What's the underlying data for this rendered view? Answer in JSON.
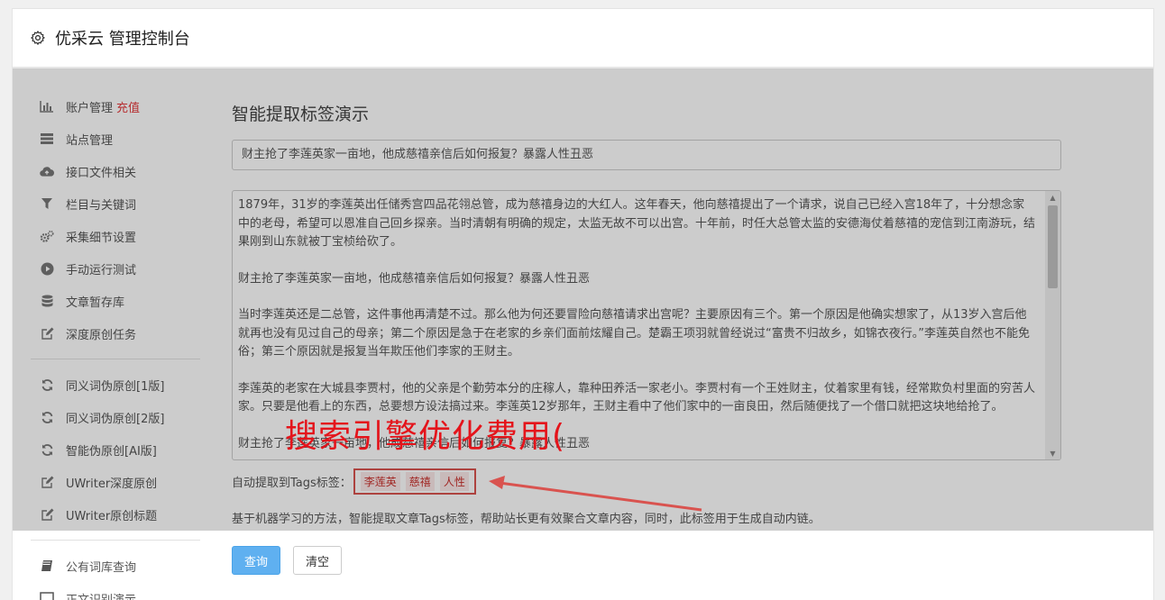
{
  "header": {
    "title": "优采云 管理控制台",
    "icon": "gear-icon"
  },
  "sidebar": {
    "items": [
      {
        "label": "账户管理",
        "badge": "充值",
        "icon": "bar-chart-icon"
      },
      {
        "label": "站点管理",
        "icon": "server-icon"
      },
      {
        "label": "接口文件相关",
        "icon": "cloud-upload-icon"
      },
      {
        "label": "栏目与关键词",
        "icon": "filter-icon"
      },
      {
        "label": "采集细节设置",
        "icon": "cogs-icon"
      },
      {
        "label": "手动运行测试",
        "icon": "play-circle-icon"
      },
      {
        "label": "文章暂存库",
        "icon": "database-icon"
      },
      {
        "label": "深度原创任务",
        "icon": "edit-icon"
      }
    ],
    "items2": [
      {
        "label": "同义词伪原创[1版]",
        "icon": "refresh-icon"
      },
      {
        "label": "同义词伪原创[2版]",
        "icon": "refresh-icon"
      },
      {
        "label": "智能伪原创[AI版]",
        "icon": "refresh-icon"
      },
      {
        "label": "UWriter深度原创",
        "icon": "edit-icon"
      },
      {
        "label": "UWriter原创标题",
        "icon": "edit-icon"
      }
    ],
    "items3": [
      {
        "label": "公有词库查询",
        "icon": "book-icon"
      },
      {
        "label": "正文识别演示",
        "icon": "monitor-icon"
      }
    ]
  },
  "main": {
    "title": "智能提取标签演示",
    "title_input": "财主抢了李莲英家一亩地，他成慈禧亲信后如何报复？暴露人性丑恶",
    "paragraphs": [
      "1879年，31岁的李莲英出任储秀宫四品花翎总管，成为慈禧身边的大红人。这年春天，他向慈禧提出了一个请求，说自己已经入宫18年了，十分想念家中的老母，希望可以恩准自己回乡探亲。当时清朝有明确的规定，太监无故不可以出宫。十年前，时任大总管太监的安德海仗着慈禧的宠信到江南游玩，结果刚到山东就被丁宝桢给砍了。",
      "财主抢了李莲英家一亩地，他成慈禧亲信后如何报复？暴露人性丑恶",
      "当时李莲英还是二总管，这件事他再清楚不过。那么他为何还要冒险向慈禧请求出宫呢？主要原因有三个。第一个原因是他确实想家了，从13岁入宫后他就再也没有见过自己的母亲；第二个原因是急于在老家的乡亲们面前炫耀自己。楚霸王项羽就曾经说过“富贵不归故乡，如锦衣夜行。”李莲英自然也不能免俗；第三个原因就是报复当年欺压他们李家的王财主。",
      "李莲英的老家在大城县李贾村，他的父亲是个勤劳本分的庄稼人，靠种田养活一家老小。李贾村有一个王姓财主，仗着家里有钱，经常欺负村里面的穷苦人家。只要是他看上的东西，总要想方设法搞过来。李莲英12岁那年，王财主看中了他们家中的一亩良田，然后随便找了一个借口就把这块地给抢了。",
      "财主抢了李莲英家一亩地，他成慈禧亲信后如何报复？暴露人性丑恶"
    ],
    "tags_label": "自动提取到Tags标签：",
    "tags": [
      "李莲英",
      "慈禧",
      "人性"
    ],
    "description": "基于机器学习的方法，智能提取文章Tags标签，帮助站长更有效聚合文章内容，同时，此标签用于生成自动内链。",
    "query_button": "查询",
    "clear_button": "清空"
  },
  "watermark": "搜索引擎优化费用(",
  "colors": {
    "accent": "#5fb0f0",
    "tag_red": "#d9534f",
    "watermark_red": "#e4141b"
  }
}
